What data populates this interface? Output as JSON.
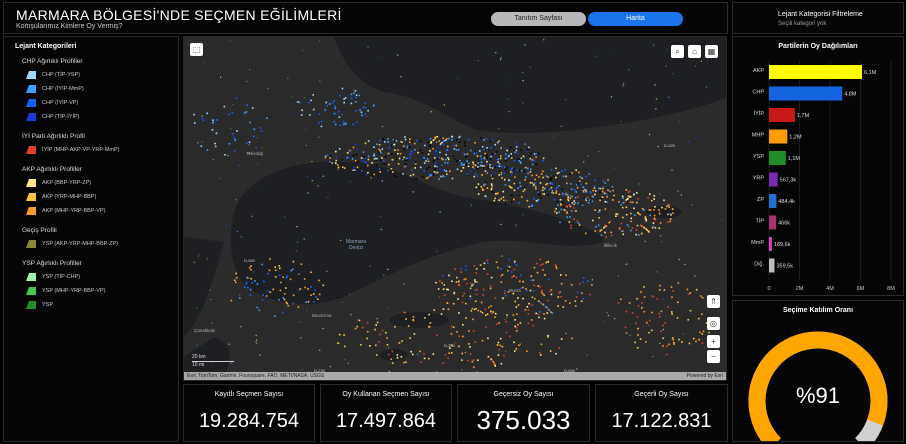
{
  "header": {
    "title": "MARMARA BÖLGESİ'NDE SEÇMEN EĞİLİMLERİ",
    "subtitle": "Komşularımız Kimlere Oy Vermiş?",
    "tabs": [
      "Tanıtım Sayfası",
      "Harita"
    ],
    "active_tab": "Harita"
  },
  "filter": {
    "title": "Lejant Kategorisi Filtreleme",
    "value": "Seçili kategori yok"
  },
  "legend": {
    "title": "Lejant Kategorileri",
    "groups": [
      {
        "label": "CHP Ağırlıklı Profiller",
        "items": [
          {
            "label": "CHP (TİP-YSP)",
            "color": "#9fd9ff"
          },
          {
            "label": "CHP (İYİP-MmP)",
            "color": "#3aa0ff"
          },
          {
            "label": "CHP (İYİP-VP)",
            "color": "#1560ff"
          },
          {
            "label": "CHP (TİP-İYİP)",
            "color": "#1a3ad6"
          }
        ]
      },
      {
        "label": "İYİ Parti Ağırlıklı Profil",
        "items": [
          {
            "label": "İYİP (MHP-AKP-VP-YRP-MmP)",
            "color": "#e0402a"
          }
        ]
      },
      {
        "label": "AKP Ağırlıklı Profiller",
        "items": [
          {
            "label": "AKP (BBP-YRP-ZP)",
            "color": "#ffe98a"
          },
          {
            "label": "AKP (YRP-MHP-BBP)",
            "color": "#ffc341"
          },
          {
            "label": "AKP (MHP-YRP-BBP-VP)",
            "color": "#ff9a2a"
          }
        ]
      },
      {
        "label": "Geçiş Profili",
        "items": [
          {
            "label": "YSP (AKP-YRP-MHP-BBP-ZP)",
            "color": "#8a8a3a"
          }
        ]
      },
      {
        "label": "YSP Ağırlıklı Profiller",
        "items": [
          {
            "label": "YSP (TİP-CHP)",
            "color": "#9cf5a8"
          },
          {
            "label": "YSP (MHP-YRP-BBP-VP)",
            "color": "#43c84d"
          },
          {
            "label": "YSP",
            "color": "#1e8e2a"
          }
        ]
      }
    ]
  },
  "map": {
    "sea_label": "Marmara\nDenizi",
    "city_labels": [
      "İstanbul",
      "Tekirdağ",
      "Bursa",
      "Çanakkale",
      "Kocaeli",
      "Bandırma",
      "Yalova",
      "Bilecik",
      "Balıkesir"
    ],
    "road_labels": [
      "D-020",
      "D-100",
      "D-555",
      "D-555",
      "D-650",
      "O-4",
      "O-7",
      "D-200",
      "D-550",
      "D-210",
      "D-230",
      "D-110"
    ],
    "scale_labels": [
      "20 km",
      "10 mi"
    ],
    "attribution": "Esri, TomTom, Garmin, Foursquare, FAO, METI/NASA, USGS",
    "powered_by": "Powered by Esri",
    "park_label": "Manyas Kuş Cenneti Milli Parkı"
  },
  "stats": [
    {
      "label": "Kayıtlı Seçmen Sayısı",
      "value": "19.284.754"
    },
    {
      "label": "Oy Kullanan Seçmen Sayısı",
      "value": "17.497.864"
    },
    {
      "label": "Geçersiz Oy Sayısı",
      "value": "375.033"
    },
    {
      "label": "Geçerli Oy Sayısı",
      "value": "17.122.831"
    }
  ],
  "chart_data": {
    "type": "bar",
    "title": "Partilerin Oy Dağılımları",
    "categories": [
      "AKP",
      "CHP",
      "İYİP",
      "MHP",
      "YSP",
      "YRP",
      "ZP",
      "TİP",
      "MmP",
      "Diğ."
    ],
    "values": [
      6100000,
      4800000,
      1700000,
      1200000,
      1100000,
      567300,
      484400,
      466000,
      189600,
      359500
    ],
    "data_labels": [
      "6,1M",
      "4,8M",
      "1,7M",
      "1,2M",
      "1,1M",
      "567,3k",
      "484,4k",
      "466k",
      "189,6k",
      "359,5k"
    ],
    "colors": [
      "#ffff00",
      "#1565e0",
      "#c81818",
      "#ff9c00",
      "#1e8e2a",
      "#7b2bb0",
      "#1e6fd0",
      "#a8326e",
      "#e838c8",
      "#bdbdbd"
    ],
    "xlim": [
      0,
      8000000
    ],
    "x_ticks": [
      "0",
      "2M",
      "4M",
      "6M",
      "8M"
    ],
    "orientation": "horizontal",
    "grid": true
  },
  "gauge": {
    "title": "Seçime Katılım Oranı",
    "value": 0.91,
    "value_label": "%91",
    "fill_color": "#ffa500",
    "track_color": "#d0d0d0"
  }
}
